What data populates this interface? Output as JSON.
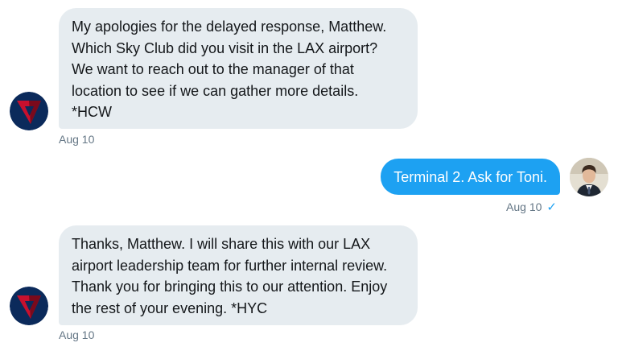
{
  "conversation": {
    "messages": [
      {
        "direction": "incoming",
        "text": "My apologies for the delayed response, Matthew.\nWhich Sky Club did you visit in the LAX airport?\nWe want to reach out to the manager of that\nlocation to see if we can gather more details.\n*HCW",
        "timestamp": "Aug 10",
        "avatar_icon": "delta-logo-icon"
      },
      {
        "direction": "outgoing",
        "text": "Terminal 2. Ask for Toni.",
        "timestamp": "Aug 10",
        "read_icon": "checkmark-icon",
        "avatar_icon": "user-photo"
      },
      {
        "direction": "incoming",
        "text": "Thanks, Matthew. I will share this with our LAX\nairport leadership team for further internal review.\nThank you for bringing this to our attention. Enjoy\nthe rest of your evening. *HYC",
        "timestamp": "Aug 10",
        "avatar_icon": "delta-logo-icon"
      }
    ]
  },
  "colors": {
    "incoming_bubble": "#e6ecf0",
    "outgoing_bubble": "#1da1f2",
    "timestamp": "#657786",
    "delta_blue": "#002e6d",
    "delta_red": "#d21e36"
  }
}
